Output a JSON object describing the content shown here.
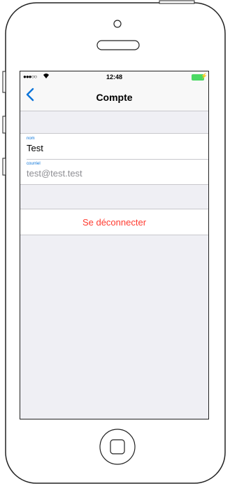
{
  "status_bar": {
    "signal": "●●●○○",
    "wifi_icon": "wifi-icon",
    "time": "12:48",
    "battery_icon": "battery-icon",
    "charge": "⚡"
  },
  "nav": {
    "back_glyph": "<",
    "title": "Compte"
  },
  "fields": {
    "name_label": "nom",
    "name_value": "Test",
    "email_label": "courriel",
    "email_value": "test@test.test"
  },
  "actions": {
    "logout_label": "Se déconnecter"
  },
  "colors": {
    "accent": "#0a74d9",
    "destructive": "#ff3b30",
    "background": "#efeff4",
    "battery": "#4cd964"
  }
}
